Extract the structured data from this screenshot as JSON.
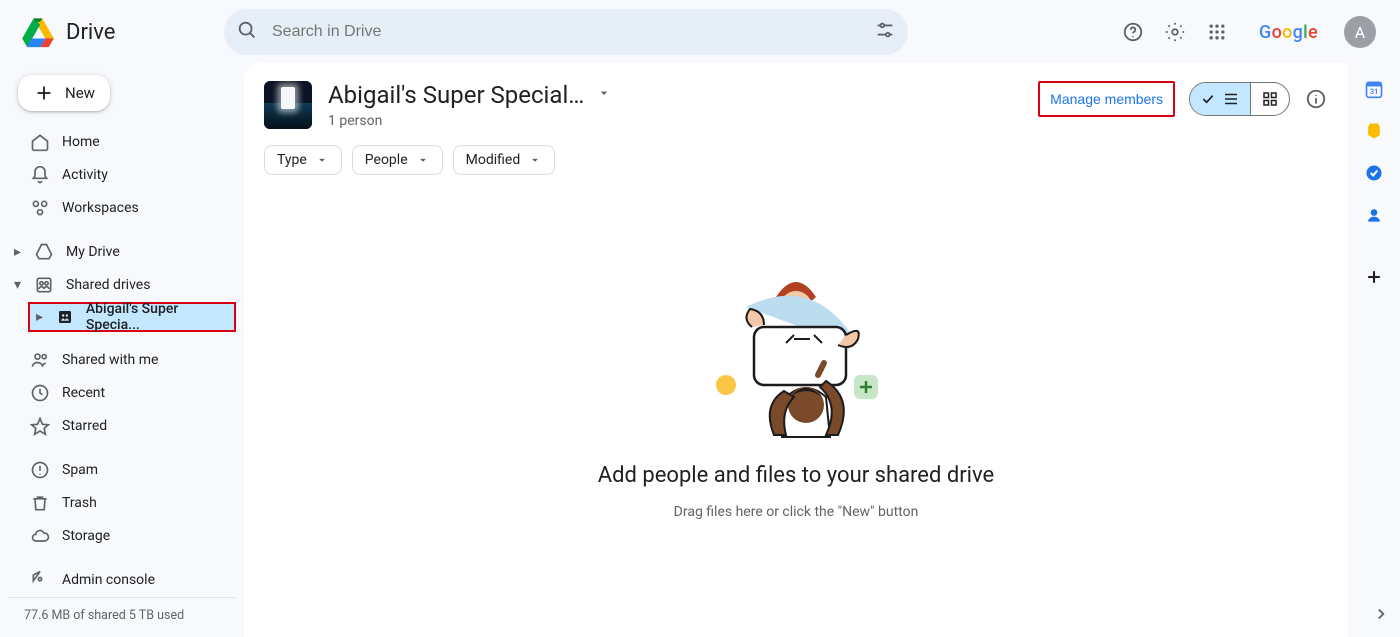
{
  "brand": {
    "name": "Drive",
    "google": "Google",
    "avatar_letter": "A"
  },
  "search": {
    "placeholder": "Search in Drive"
  },
  "header": {
    "drive_title": "Abigail's Super Special S...",
    "subtitle": "1 person",
    "manage_members": "Manage members"
  },
  "filters": {
    "type": "Type",
    "people": "People",
    "modified": "Modified"
  },
  "empty": {
    "heading": "Add people and files to your shared drive",
    "sub": "Drag files here or click the \"New\" button"
  },
  "sidebar": {
    "new_label": "New",
    "items": {
      "home": "Home",
      "activity": "Activity",
      "workspaces": "Workspaces",
      "my_drive": "My Drive",
      "shared_drives": "Shared drives",
      "sub_drive": "Abigail's Super Specia...",
      "shared_with_me": "Shared with me",
      "recent": "Recent",
      "starred": "Starred",
      "spam": "Spam",
      "trash": "Trash",
      "storage": "Storage",
      "admin": "Admin console"
    },
    "storage_text": "77.6 MB of shared 5 TB used"
  }
}
